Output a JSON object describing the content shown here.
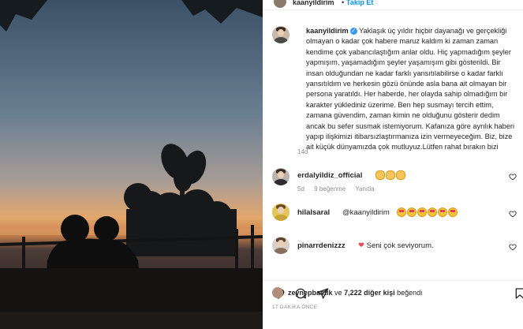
{
  "post": {
    "username": "kaanyildirim",
    "follow_label": "Takip Et",
    "caption": "Yaklaşık üç yıldır hiçbir dayanağı ve gerçekliği olmayan o kadar çok habere maruz kaldım ki zaman zaman kendime çok yabancılaştığım anlar oldu. Hiç yapmadığım şeyler yapmışım, yaşamadığım şeyler yaşamışım gibi gösterildi. Bir insan olduğundan ne kadar farklı yansıtılabilirse o kadar farklı yansıtıldım ve herkesin gözü önünde asla bana ait olmayan bir persona yaratıldı. Her haberde, her olayda sahip olmadığım bir karakter yüklediniz üzerime. Ben hep susmayı tercih ettim, zamana güvendim, zaman kimin ne olduğunu gösterir dedim ancak bu sefer susmak istemiyorum. Kafanıza göre ayrılık haberi yapıp ilişkimizi itibarsızlaştırmanıza izin vermeyeceğim. Biz, bize ait küçük dünyamızda çok mutluyuz.Lütfen rahat bırakın bizi",
    "time_ago": "14d"
  },
  "comments": [
    {
      "username": "erdalyildiz_official",
      "emojis": [
        "clap",
        "clap",
        "clap"
      ],
      "time": "5d",
      "likes": "9 beğenme",
      "reply": "Yanıtla"
    },
    {
      "username": "hilalsaral",
      "mention": "@kaanyildirim",
      "emojis": [
        "hearteyes",
        "hearteyes",
        "hearteyes",
        "hearteyes",
        "hearteyes",
        "hearteyes"
      ],
      "time": "",
      "likes": "",
      "reply": ""
    },
    {
      "username": "pinarrdenizzz",
      "text": "Seni çok seviyorum.",
      "heart": "red-heart",
      "time": "",
      "likes": "",
      "reply": ""
    }
  ],
  "footer": {
    "liked_by_user": "zeynepbastik",
    "liked_connector": "ve",
    "liked_others": "7,222 diğer kişi",
    "liked_suffix": "beğendi",
    "posted_time": "17 DAKİKA ÖNCE"
  },
  "icons": {
    "like": "heart-outline-icon",
    "comment": "comment-icon",
    "share": "paper-plane-icon",
    "save": "bookmark-icon",
    "verified": "verified-badge-icon"
  },
  "colors": {
    "link_blue": "#0095f6",
    "verified_blue": "#3897f0",
    "secondary_text": "#8e8e8e",
    "heart_red": "#ed4956"
  }
}
